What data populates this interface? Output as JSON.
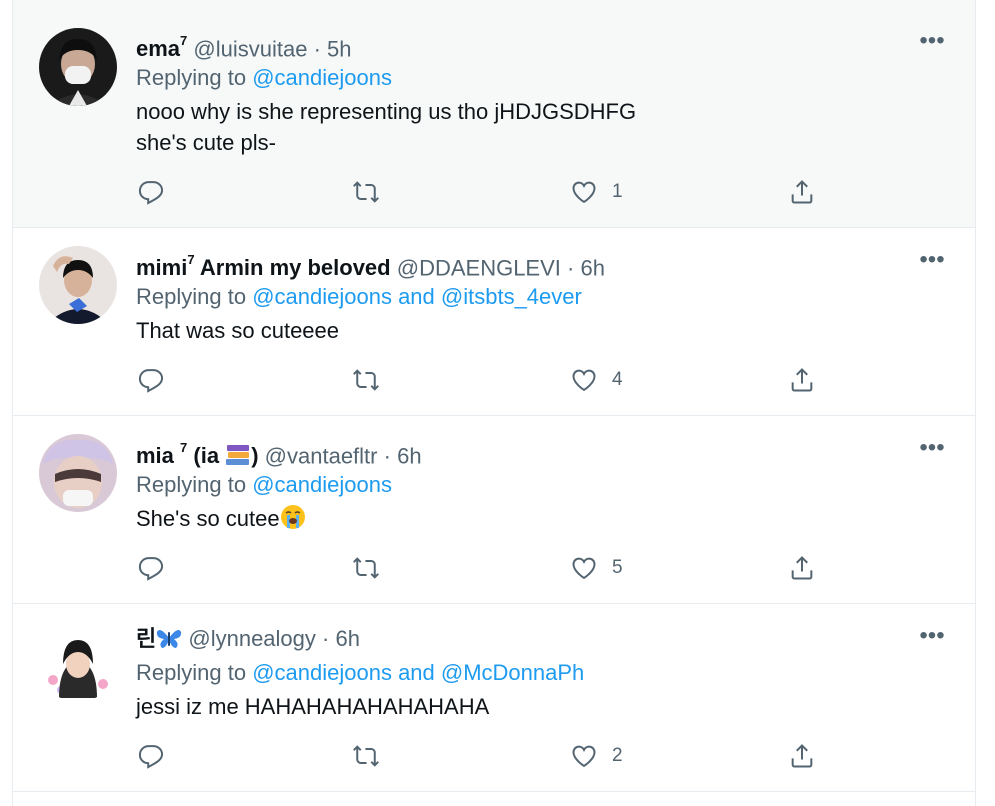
{
  "tweets": [
    {
      "display_name": "ema",
      "superscript": "7",
      "handle": "@luisvuitae",
      "time": "5h",
      "replying_label": "Replying to",
      "replying_to": "@candiejoons",
      "text": "nooo why is she representing us tho jHDJGSDHFG\nshe's cute pls-",
      "likes": "1"
    },
    {
      "display_name": "mimi",
      "superscript": "7",
      "display_name_suffix": "Armin my beloved",
      "handle": "@DDAENGLEVI",
      "time": "6h",
      "replying_label": "Replying to",
      "replying_to": "@candiejoons and @itsbts_4ever",
      "text": "That was so cuteeee",
      "likes": "4"
    },
    {
      "display_name": "mia",
      "superscript": "7",
      "display_name_suffix": "(ia",
      "display_name_close": ")",
      "handle": "@vantaefltr",
      "time": "6h",
      "replying_label": "Replying to",
      "replying_to": "@candiejoons",
      "text": "She's so cutee",
      "likes": "5"
    },
    {
      "display_name": "린",
      "handle": "@lynnealogy",
      "time": "6h",
      "replying_label": "Replying to",
      "replying_to": "@candiejoons and @McDonnaPh",
      "text": "jessi iz me HAHAHAHAHAHAHAHA",
      "likes": "2"
    }
  ],
  "separator": "·",
  "more_label": "•••",
  "icons": [
    "reply-icon",
    "retweet-icon",
    "like-icon",
    "share-icon",
    "more-icon"
  ],
  "colors": {
    "link": "#1d9bf0",
    "muted": "#536471",
    "hover_bg": "#f7f9f9"
  }
}
